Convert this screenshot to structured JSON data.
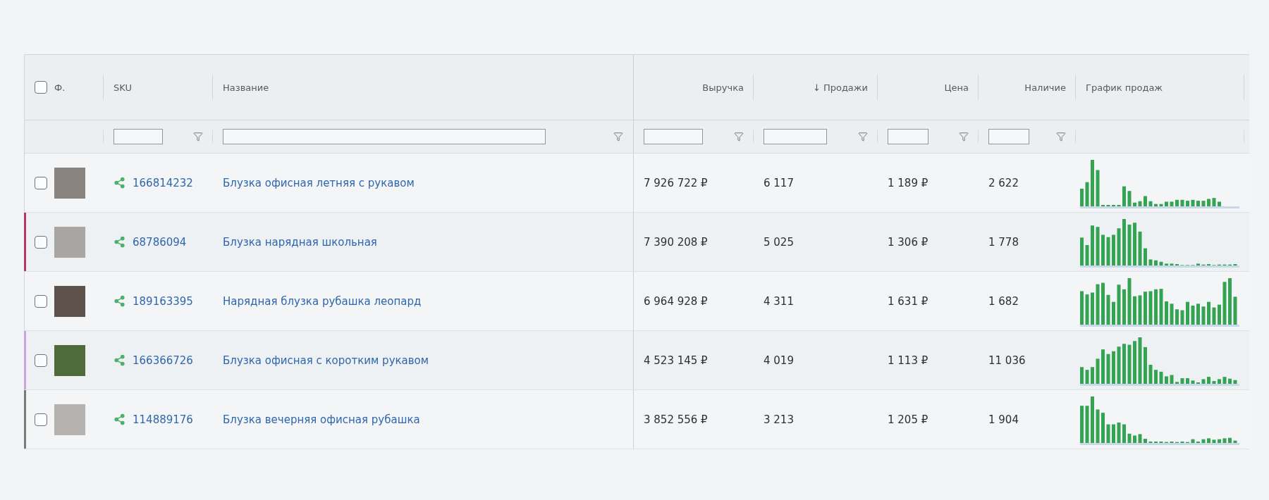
{
  "table": {
    "header_checkbox": {
      "checked": false
    },
    "columns": [
      {
        "label": "Ф.",
        "kind": "photo",
        "filter": false
      },
      {
        "label": "SKU",
        "kind": "text",
        "filter": true
      },
      {
        "label": "Название",
        "kind": "text",
        "filter": true
      },
      {
        "label": "Выручка",
        "kind": "number",
        "filter": true
      },
      {
        "label": "↓ Продажи",
        "kind": "number",
        "filter": true
      },
      {
        "label": "Цена",
        "kind": "number",
        "filter": true
      },
      {
        "label": "Наличие",
        "kind": "number",
        "filter": true
      },
      {
        "label": "График продаж",
        "kind": "chart",
        "filter": false
      }
    ],
    "rows": [
      {
        "checked": false,
        "sku": "166814232",
        "name": "Блузка офисная летняя с рукавом",
        "revenue": "7 926 722 ₽",
        "sales": "6 117",
        "price": "1 189 ₽",
        "stock": "2 622"
      },
      {
        "checked": false,
        "color": "#b8336a",
        "sku": "68786094",
        "name": "Блузка нарядная школьная",
        "revenue": "7 390 208 ₽",
        "sales": "5 025",
        "price": "1 306 ₽",
        "stock": "1 778"
      },
      {
        "checked": false,
        "sku": "189163395",
        "name": "Нарядная блузка рубашка леопард",
        "revenue": "6 964 928 ₽",
        "sales": "4 311",
        "price": "1 631 ₽",
        "stock": "1 682"
      },
      {
        "checked": false,
        "color": "#c9a3e0",
        "sku": "166366726",
        "name": "Блузка офисная с коротким рукавом",
        "revenue": "4 523 145 ₽",
        "sales": "4 019",
        "price": "1 113 ₽",
        "stock": "11 036"
      },
      {
        "checked": false,
        "color": "#7a7a7a",
        "sku": "114889176",
        "name": "Блузка вечерняя офисная рубашка",
        "revenue": "3 852 556 ₽",
        "sales": "3 213",
        "price": "1 205 ₽",
        "stock": "1 904"
      }
    ]
  }
}
